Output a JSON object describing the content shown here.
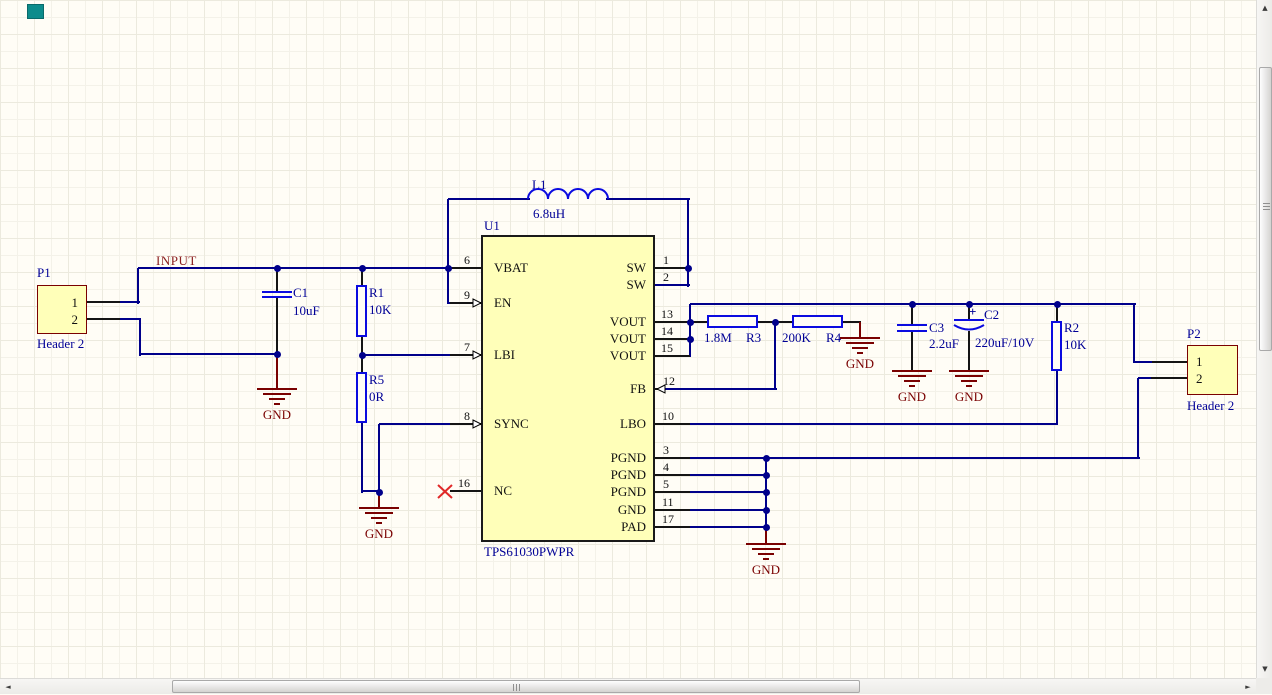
{
  "net_labels": {
    "input": "INPUT"
  },
  "power": {
    "gnd": "GND"
  },
  "components": {
    "u1": {
      "designator": "U1",
      "comment": "TPS61030PWPR",
      "pins_left": [
        {
          "num": "6",
          "name": "VBAT"
        },
        {
          "num": "9",
          "name": "EN"
        },
        {
          "num": "7",
          "name": "LBI"
        },
        {
          "num": "8",
          "name": "SYNC"
        },
        {
          "num": "16",
          "name": "NC"
        }
      ],
      "pins_right": [
        {
          "num": "1",
          "name": "SW"
        },
        {
          "num": "2",
          "name": "SW"
        },
        {
          "num": "13",
          "name": "VOUT"
        },
        {
          "num": "14",
          "name": "VOUT"
        },
        {
          "num": "15",
          "name": "VOUT"
        },
        {
          "num": "12",
          "name": "FB"
        },
        {
          "num": "10",
          "name": "LBO"
        },
        {
          "num": "3",
          "name": "PGND"
        },
        {
          "num": "4",
          "name": "PGND"
        },
        {
          "num": "5",
          "name": "PGND"
        },
        {
          "num": "11",
          "name": "GND"
        },
        {
          "num": "17",
          "name": "PAD"
        }
      ]
    },
    "p1": {
      "designator": "P1",
      "comment": "Header 2",
      "pin1": "1",
      "pin2": "2"
    },
    "p2": {
      "designator": "P2",
      "comment": "Header 2",
      "pin1": "1",
      "pin2": "2"
    },
    "l1": {
      "designator": "L1",
      "value": "6.8uH"
    },
    "c1": {
      "designator": "C1",
      "value": "10uF"
    },
    "c2": {
      "designator": "C2",
      "value": "220uF/10V",
      "polarity": "+"
    },
    "c3": {
      "designator": "C3",
      "value": "2.2uF"
    },
    "r1": {
      "designator": "R1",
      "value": "10K"
    },
    "r2": {
      "designator": "R2",
      "value": "10K"
    },
    "r3": {
      "designator": "R3",
      "value": "1.8M"
    },
    "r4": {
      "designator": "R4",
      "value": "200K"
    },
    "r5": {
      "designator": "R5",
      "value": "0R"
    }
  },
  "colors": {
    "wire": "#00008B",
    "symbol_outline": "#0B0BE0",
    "text_navy": "#000096",
    "maroon": "#7A0101",
    "net_label": "#8B2020",
    "body_fill": "#FFFFB9",
    "noerc_red": "#E02828",
    "marker_teal": "#0D8C8C"
  }
}
